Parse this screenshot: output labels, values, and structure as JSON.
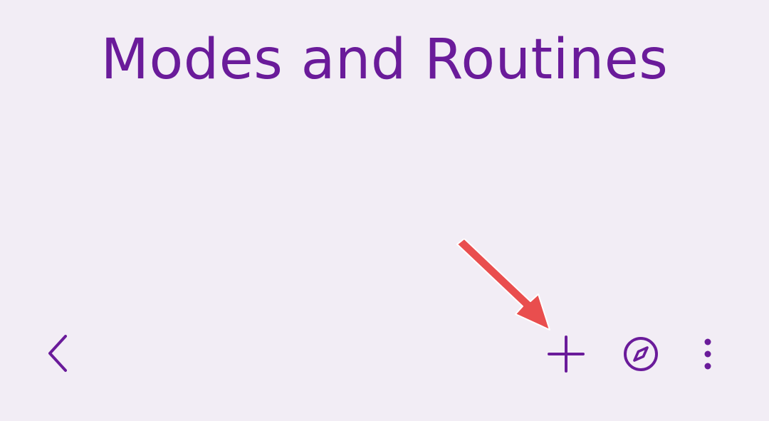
{
  "header": {
    "title": "Modes and Routines"
  },
  "toolbar": {
    "items": [
      {
        "name": "back",
        "icon": "chevron-left-icon"
      },
      {
        "name": "add",
        "icon": "plus-icon"
      },
      {
        "name": "discover",
        "icon": "compass-icon"
      },
      {
        "name": "more_options",
        "icon": "more-vertical-icon"
      }
    ]
  },
  "annotation": {
    "type": "arrow",
    "points_to": "add-button",
    "color": "#e94e4e"
  },
  "theme": {
    "background": "#f2edf5",
    "accent": "#6a1b9a"
  }
}
